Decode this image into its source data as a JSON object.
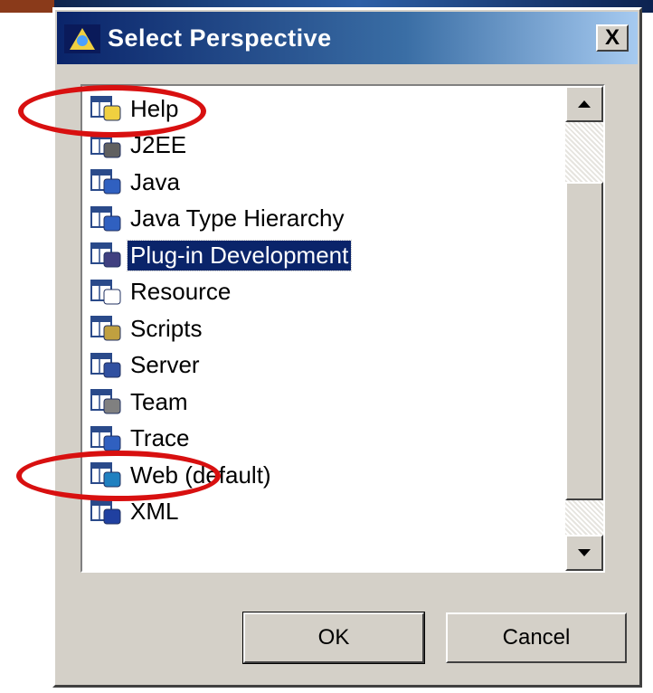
{
  "dialog": {
    "title": "Select Perspective",
    "close_label": "X",
    "ok_label": "OK",
    "cancel_label": "Cancel"
  },
  "perspectives": [
    {
      "label": "Help",
      "icon": "help-perspective-icon"
    },
    {
      "label": "J2EE",
      "icon": "j2ee-perspective-icon"
    },
    {
      "label": "Java",
      "icon": "java-perspective-icon"
    },
    {
      "label": "Java Type Hierarchy",
      "icon": "java-type-hierarchy-icon"
    },
    {
      "label": "Plug-in Development",
      "icon": "plugin-development-icon",
      "selected": true
    },
    {
      "label": "Resource",
      "icon": "resource-perspective-icon"
    },
    {
      "label": "Scripts",
      "icon": "scripts-perspective-icon"
    },
    {
      "label": "Server",
      "icon": "server-perspective-icon"
    },
    {
      "label": "Team",
      "icon": "team-perspective-icon"
    },
    {
      "label": "Trace",
      "icon": "trace-perspective-icon"
    },
    {
      "label": "Web (default)",
      "icon": "web-perspective-icon"
    },
    {
      "label": "XML",
      "icon": "xml-perspective-icon"
    }
  ],
  "colors": {
    "selection": "#0a246a",
    "annotation": "#d81010",
    "dialog_face": "#d4d0c8"
  }
}
